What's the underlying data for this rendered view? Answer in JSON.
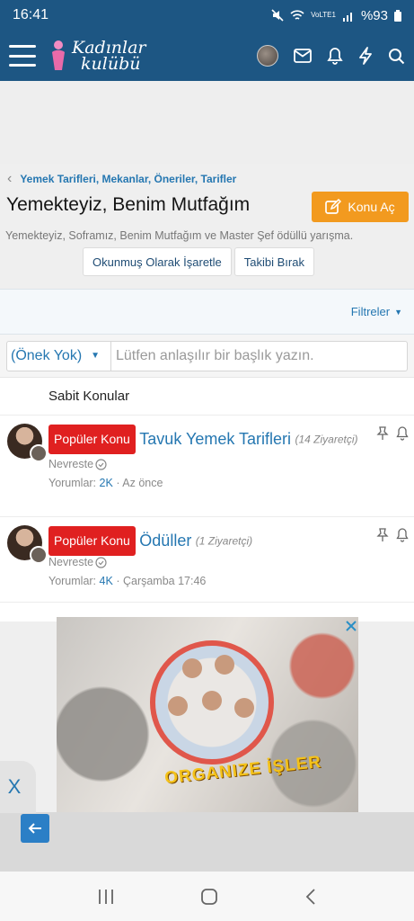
{
  "status_bar": {
    "time": "16:41",
    "battery": "%93",
    "network": "VoLTE1"
  },
  "header": {
    "logo_line1": "Kadınlar",
    "logo_line2": "kulübü",
    "icons": [
      "menu-icon",
      "user-avatar",
      "mail-icon",
      "bell-icon",
      "bolt-icon",
      "search-icon"
    ]
  },
  "breadcrumb": {
    "label": "Yemek Tarifleri, Mekanlar, Öneriler, Tarifler"
  },
  "forum": {
    "title": "Yemekteyiz, Benim Mutfağım",
    "new_topic_label": "Konu Aç",
    "description": "Yemekteyiz, Soframız, Benim Mutfağım ve Master Şef ödüllü yarışma.",
    "mark_read_label": "Okunmuş Olarak İşaretle",
    "unwatch_label": "Takibi Bırak"
  },
  "filters": {
    "label": "Filtreler"
  },
  "quick_thread": {
    "prefix_value": "(Önek Yok)",
    "placeholder": "Lütfen anlaşılır bir başlık yazın."
  },
  "sticky_section": {
    "label": "Sabit Konular"
  },
  "threads": [
    {
      "badge": "Popüler Konu",
      "title": "Tavuk Yemek Tarifleri",
      "visitors": "(14 Ziyaretçi)",
      "author": "Nevreste",
      "replies_label": "Yorumlar:",
      "replies": "2K",
      "separator": "·",
      "last_activity": "Az önce"
    },
    {
      "badge": "Popüler Konu",
      "title": "Ödüller",
      "visitors": "(1 Ziyaretçi)",
      "author": "Nevreste",
      "replies_label": "Yorumlar:",
      "replies": "4K",
      "separator": "·",
      "last_activity": "Çarşamba 17:46"
    }
  ],
  "ad": {
    "headline": "ORGANIZE İŞLER"
  },
  "side_tab": {
    "label": "X"
  },
  "colors": {
    "header_bg": "#1d5683",
    "link": "#2577b1",
    "accent_button": "#f29a1f",
    "badge_red": "#e02020"
  }
}
